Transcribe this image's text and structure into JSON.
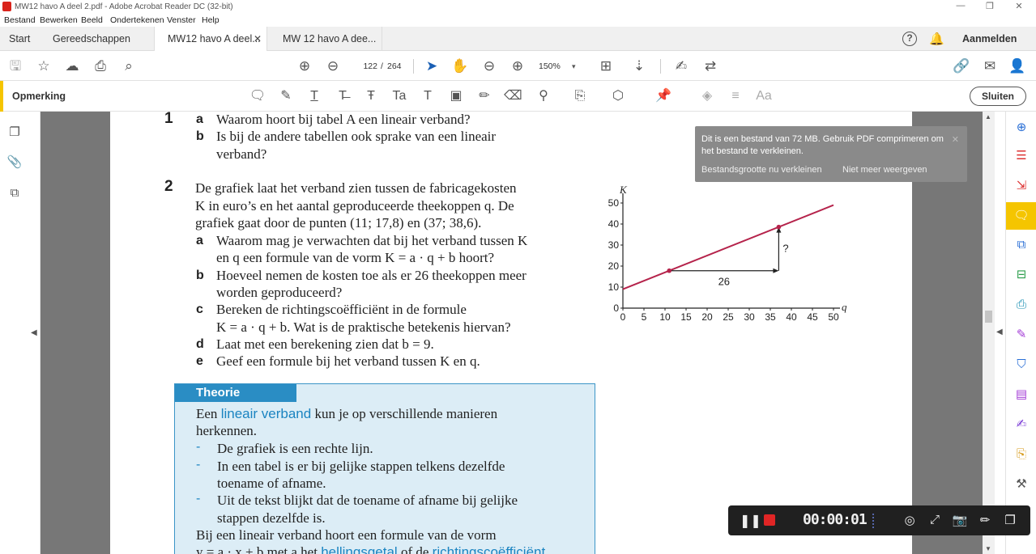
{
  "window": {
    "title": "MW12 havo A deel 2.pdf - Adobe Acrobat Reader DC (32-bit)",
    "min": "—",
    "max": "❐",
    "close": "✕"
  },
  "menu": [
    "Bestand",
    "Bewerken",
    "Beeld",
    "Ondertekenen",
    "Venster",
    "Help"
  ],
  "tabs": {
    "start": "Start",
    "tools": "Gereedschappen",
    "doc1": "MW12 havo A deel...",
    "doc2": "MW 12 havo A dee...",
    "close_glyph": "✕",
    "help": "?",
    "signin": "Aanmelden"
  },
  "toolbar": {
    "page_current": "122",
    "page_sep": "/",
    "page_total": "264",
    "zoom": "150%",
    "zoom_caret": "▾"
  },
  "comment_bar": {
    "label": "Opmerking",
    "close": "Sluiten"
  },
  "document": {
    "q1": {
      "num": "1",
      "a_label": "a",
      "a": "Waarom hoort bij tabel A een lineair verband?",
      "b_label": "b",
      "b1": "Is bij de andere tabellen ook sprake van een lineair",
      "b2": "verband?"
    },
    "q2": {
      "num": "2",
      "intro1": "De grafiek laat het verband zien tussen de fabricagekosten",
      "intro2": "K in euro’s en het aantal geproduceerde theekoppen q. De",
      "intro3": "grafiek gaat door de punten (11; 17,8) en (37; 38,6).",
      "a_label": "a",
      "a1": "Waarom mag je verwachten dat bij het verband tussen K",
      "a2": "en q een formule van de vorm K = a · q + b hoort?",
      "b_label": "b",
      "b1": "Hoeveel nemen de kosten toe als er 26 theekoppen meer",
      "b2": "worden geproduceerd?",
      "c_label": "c",
      "c1": "Bereken de richtingscoëfficiënt in de formule",
      "c2": "K = a · q + b. Wat is de praktische betekenis hiervan?",
      "d_label": "d",
      "d": "Laat met een berekening zien dat b = 9.",
      "e_label": "e",
      "e": "Geef een formule bij het verband tussen K en q."
    },
    "theory": {
      "heading": "Theorie",
      "l1_pre": "Een ",
      "l1_blue": "lineair verband",
      "l1_post": " kun je op verschillende manieren",
      "l2": "herkennen.",
      "dash": "-",
      "i1": "De grafiek is een rechte lijn.",
      "i2a": "In een tabel is er bij gelijke stappen telkens dezelfde",
      "i2b": "toename of afname.",
      "i3a": "Uit de tekst blijkt dat de toename of afname bij gelijke",
      "i3b": "stappen dezelfde is.",
      "l3": "Bij een lineair verband hoort een formule van de vorm",
      "l4_pre": "y = a · x + b met a het ",
      "l4_blue1": "hellingsgetal",
      "l4_mid": " of de ",
      "l4_blue2": "richtingscoëfficiënt"
    }
  },
  "chart_data": {
    "type": "line",
    "xlabel": "q",
    "ylabel": "K",
    "xlim": [
      0,
      50
    ],
    "ylim": [
      0,
      50
    ],
    "x_ticks": [
      "0",
      "5",
      "10",
      "15",
      "20",
      "25",
      "30",
      "35",
      "40",
      "45",
      "50"
    ],
    "y_ticks": [
      "0",
      "10",
      "20",
      "30",
      "40",
      "50"
    ],
    "line": [
      [
        0,
        9
      ],
      [
        50,
        49
      ]
    ],
    "points": [
      [
        11,
        17.8
      ],
      [
        37,
        38.6
      ]
    ],
    "annotations": {
      "horizontal": "26",
      "vertical": "?"
    },
    "colors": {
      "line": "#b5234b",
      "axis": "#222222"
    }
  },
  "popup": {
    "message": "Dit is een bestand van 72 MB. Gebruik PDF comprimeren om het bestand te verkleinen.",
    "link1": "Bestandsgrootte nu verkleinen",
    "link2": "Niet meer weergeven",
    "close": "✕"
  },
  "recorder": {
    "time": "00:00:01",
    "pause": "❚❚"
  },
  "colors": {
    "accent_yellow": "#f5c500",
    "theory_blue": "#2a8dc4",
    "theory_bg": "#dcedf6"
  }
}
